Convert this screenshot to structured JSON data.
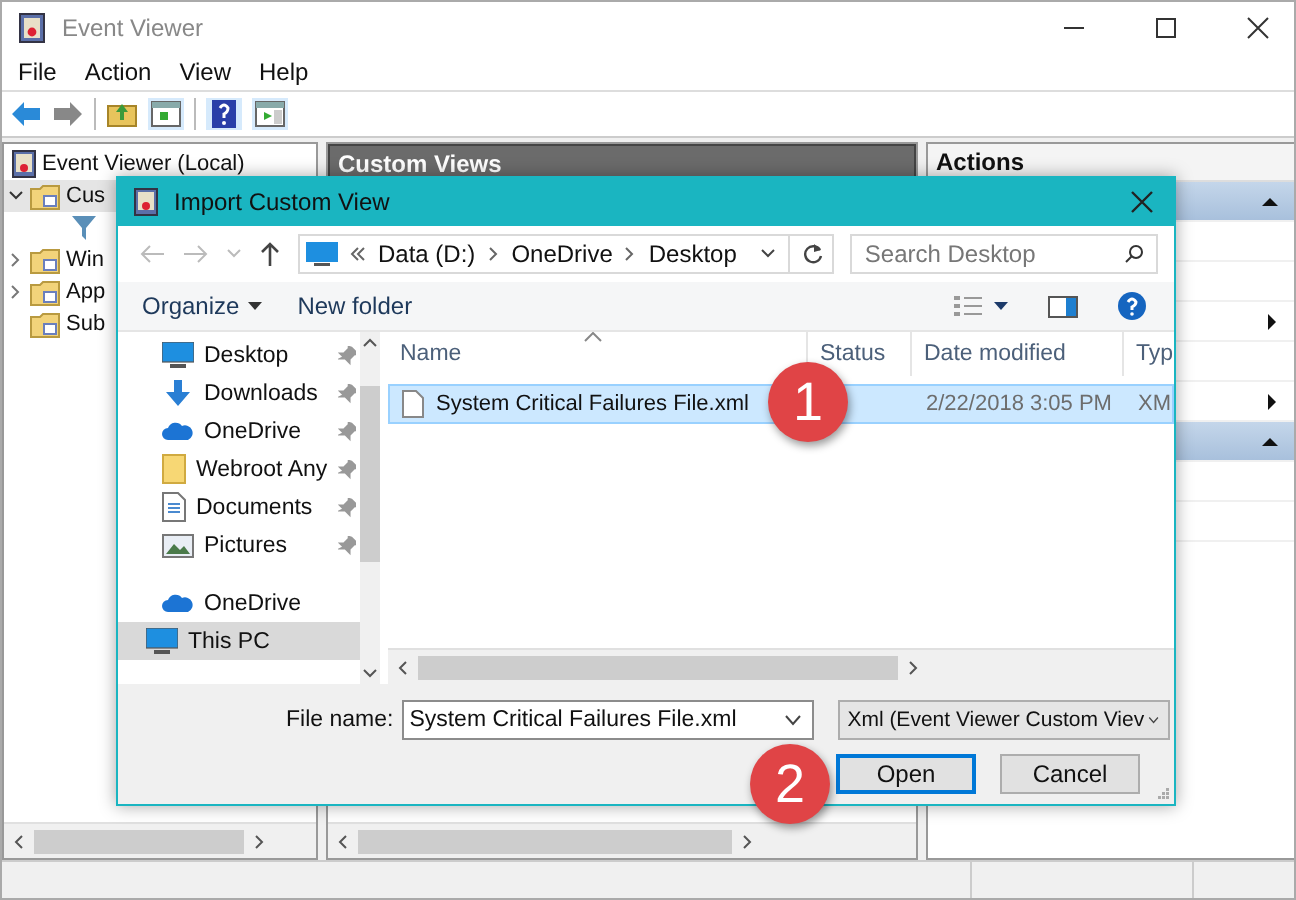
{
  "window": {
    "title": "Event Viewer"
  },
  "menu": [
    "File",
    "Action",
    "View",
    "Help"
  ],
  "tree": {
    "root": "Event Viewer (Local)",
    "items": [
      {
        "label": "Cus",
        "expanded": true,
        "kind": "folder"
      },
      {
        "label": "Win",
        "expanded": false,
        "kind": "folder"
      },
      {
        "label": "App",
        "expanded": false,
        "kind": "folder"
      },
      {
        "label": "Sub",
        "kind": "folder"
      }
    ]
  },
  "middle": {
    "header": "Custom Views"
  },
  "actions": {
    "header": "Actions",
    "rows": [
      {
        "kind": "section"
      },
      {
        "kind": "blank"
      },
      {
        "kind": "blank"
      },
      {
        "kind": "submenu"
      },
      {
        "kind": "blank"
      },
      {
        "kind": "submenu"
      },
      {
        "kind": "section"
      },
      {
        "kind": "blank"
      },
      {
        "kind": "blank"
      }
    ]
  },
  "dialog": {
    "title": "Import Custom View",
    "path": [
      "Data (D:)",
      "OneDrive",
      "Desktop"
    ],
    "search": {
      "placeholder": "Search Desktop"
    },
    "toolbar": [
      "Organize",
      "New folder"
    ],
    "nav": [
      {
        "label": "Desktop",
        "kind": "desktop",
        "pinned": true,
        "selected": false
      },
      {
        "label": "Downloads",
        "kind": "download",
        "pinned": true,
        "selected": false
      },
      {
        "label": "OneDrive",
        "kind": "cloud",
        "pinned": true,
        "selected": false
      },
      {
        "label": "Webroot Any",
        "kind": "folder",
        "pinned": true,
        "selected": false
      },
      {
        "label": "Documents",
        "kind": "document",
        "pinned": true,
        "selected": false
      },
      {
        "label": "Pictures",
        "kind": "pictures",
        "pinned": true,
        "selected": false
      },
      {
        "kind": "gap"
      },
      {
        "label": "OneDrive",
        "kind": "cloud",
        "pinned": false,
        "selected": false
      },
      {
        "label": "This PC",
        "kind": "desktop",
        "pinned": false,
        "selected": true
      }
    ],
    "columns": [
      "Name",
      "Status",
      "Date modified",
      "Typ"
    ],
    "files": [
      {
        "name": "System Critical Failures File.xml",
        "date": "2/22/2018 3:05 PM",
        "type": "XM",
        "selected": true
      }
    ],
    "filename_label": "File name:",
    "filename": "System Critical Failures File.xml",
    "filter": "Xml (Event Viewer Custom Viev",
    "buttons": [
      {
        "label": "Open",
        "default": true
      },
      {
        "label": "Cancel",
        "default": false
      }
    ]
  },
  "badges": [
    "1",
    "2"
  ]
}
